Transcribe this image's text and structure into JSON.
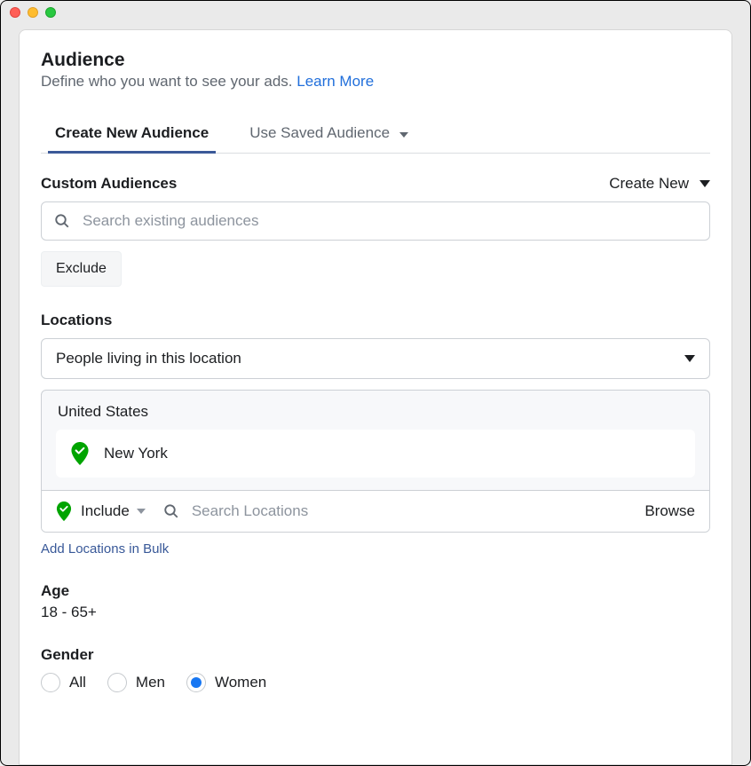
{
  "header": {
    "title": "Audience",
    "subtitle": "Define who you want to see your ads.",
    "learn_more": "Learn More"
  },
  "tabs": {
    "create": "Create New Audience",
    "saved": "Use Saved Audience"
  },
  "custom_audiences": {
    "title": "Custom Audiences",
    "create_new": "Create New",
    "search_placeholder": "Search existing audiences",
    "exclude": "Exclude"
  },
  "locations": {
    "title": "Locations",
    "select": "People living in this location",
    "country": "United States",
    "city": "New York",
    "include": "Include",
    "search_placeholder": "Search Locations",
    "browse": "Browse",
    "bulk": "Add Locations in Bulk"
  },
  "age": {
    "title": "Age",
    "value": "18 - 65+"
  },
  "gender": {
    "title": "Gender",
    "options": {
      "all": "All",
      "men": "Men",
      "women": "Women"
    },
    "selected": "women"
  }
}
